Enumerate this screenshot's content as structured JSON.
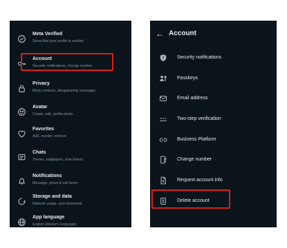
{
  "settings_list": {
    "items": [
      {
        "title": "Meta Verified",
        "subtitle": "Show that your profile is verified",
        "icon": "verified-badge-icon"
      },
      {
        "title": "Account",
        "subtitle": "Security notifications, change number",
        "icon": "key-icon"
      },
      {
        "title": "Privacy",
        "subtitle": "Block contacts, disappearing messages",
        "icon": "lock-icon"
      },
      {
        "title": "Avatar",
        "subtitle": "Create, edit, profile photo",
        "icon": "avatar-icon"
      },
      {
        "title": "Favorites",
        "subtitle": "Add, reorder, remove",
        "icon": "heart-icon"
      },
      {
        "title": "Chats",
        "subtitle": "Theme, wallpapers, chat history",
        "icon": "chat-icon"
      },
      {
        "title": "Notifications",
        "subtitle": "Message, group & call tones",
        "icon": "bell-icon"
      },
      {
        "title": "Storage and data",
        "subtitle": "Network usage, auto-download",
        "icon": "storage-icon"
      },
      {
        "title": "App language",
        "subtitle": "English (device's language)",
        "icon": "globe-icon"
      }
    ]
  },
  "account_screen": {
    "back_icon": "back-arrow-icon",
    "title": "Account",
    "items": [
      {
        "label": "Security notifications",
        "icon": "shield-icon"
      },
      {
        "label": "Passkeys",
        "icon": "passkey-icon"
      },
      {
        "label": "Email address",
        "icon": "mail-icon"
      },
      {
        "label": "Two-step verification",
        "icon": "pin-dots-icon"
      },
      {
        "label": "Business Platform",
        "icon": "link-icon"
      },
      {
        "label": "Change number",
        "icon": "phone-change-icon"
      },
      {
        "label": "Request account info",
        "icon": "document-icon"
      },
      {
        "label": "Delete account",
        "icon": "trash-icon"
      }
    ]
  },
  "colors": {
    "background": "#0b141a",
    "highlight": "#d8201e",
    "primary_text": "#e9edef",
    "secondary_text": "#8696a0"
  }
}
